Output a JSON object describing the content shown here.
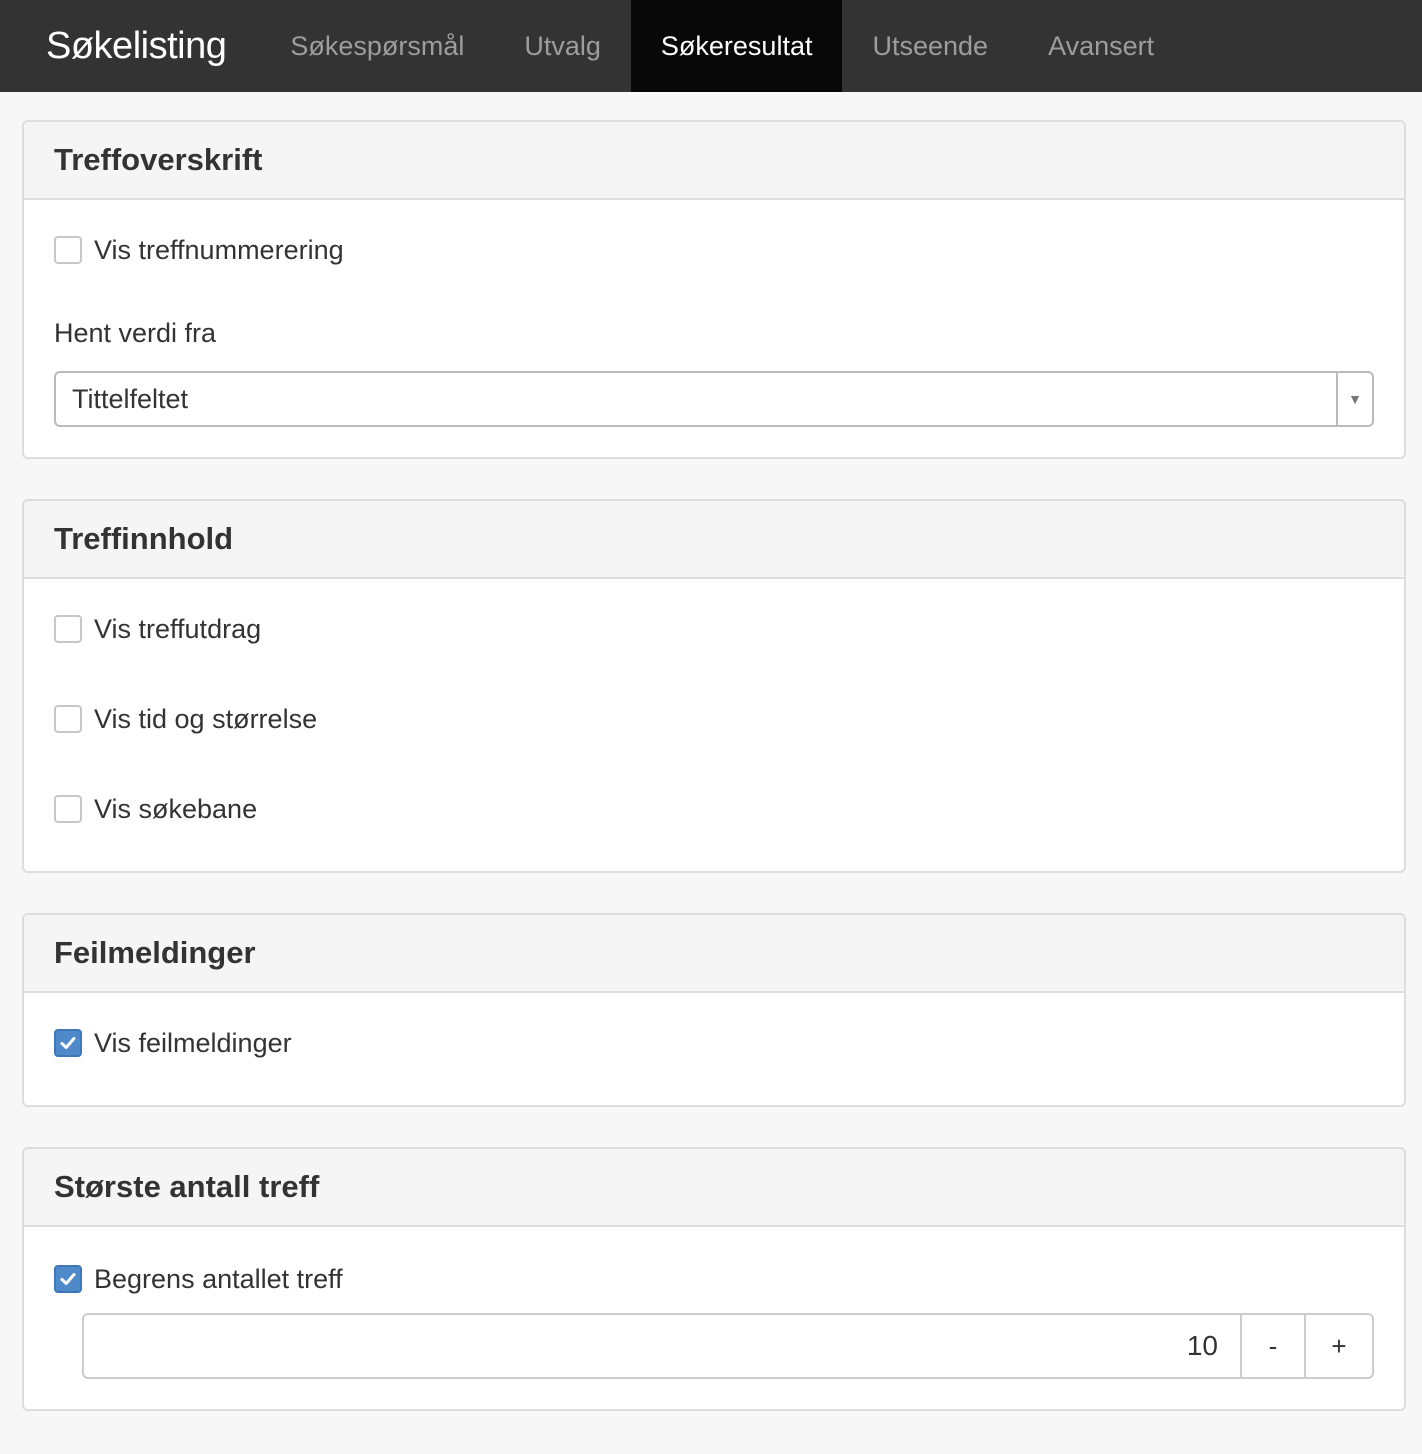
{
  "navbar": {
    "brand": "Søkelisting",
    "tabs": [
      {
        "label": "Søkespørsmål",
        "active": false
      },
      {
        "label": "Utvalg",
        "active": false
      },
      {
        "label": "Søkeresultat",
        "active": true
      },
      {
        "label": "Utseende",
        "active": false
      },
      {
        "label": "Avansert",
        "active": false
      }
    ]
  },
  "panels": {
    "heading_title": {
      "title": "Treffoverskrift",
      "show_numbering": {
        "label": "Vis treffnummerering",
        "checked": false
      },
      "value_from": {
        "label": "Hent verdi fra",
        "selected": "Tittelfeltet"
      }
    },
    "content": {
      "title": "Treffinnhold",
      "show_excerpt": {
        "label": "Vis treffutdrag",
        "checked": false
      },
      "show_time_size": {
        "label": "Vis tid og størrelse",
        "checked": false
      },
      "show_path": {
        "label": "Vis søkebane",
        "checked": false
      }
    },
    "errors": {
      "title": "Feilmeldinger",
      "show_errors": {
        "label": "Vis feilmeldinger",
        "checked": true
      }
    },
    "max_hits": {
      "title": "Største antall treff",
      "limit": {
        "label": "Begrens antallet treff",
        "checked": true
      },
      "value": "10",
      "decrement": "-",
      "increment": "+"
    }
  },
  "colors": {
    "navbar_bg": "#333333",
    "navbar_active_bg": "#080808",
    "checkbox_checked": "#4f89c9"
  }
}
